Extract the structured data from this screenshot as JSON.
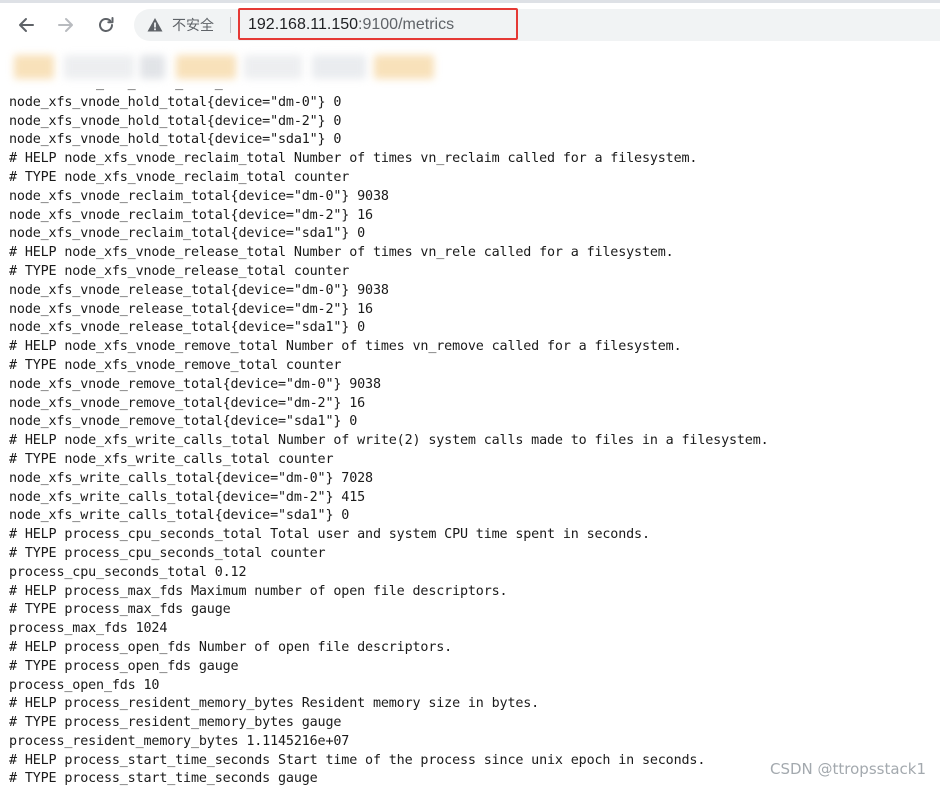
{
  "browser": {
    "security_label": "不安全",
    "url_host": "192.168.11.150",
    "url_port": ":9100",
    "url_path": "/metrics",
    "icons": {
      "back": "back-arrow-icon",
      "forward": "forward-arrow-icon",
      "reload": "reload-icon",
      "security": "warning-triangle-icon"
    },
    "highlight_color": "#e53935"
  },
  "bookmarks_blurred": [
    {
      "color": "#f6d7a3"
    },
    {
      "color": "#e7e9ec"
    },
    {
      "color": "#d8dbe0"
    },
    {
      "color": "#f6d7a3"
    },
    {
      "color": "#e7e9ec"
    },
    {
      "color": "#e3e6ea"
    },
    {
      "color": "#f6d7a3"
    }
  ],
  "metrics_lines": [
    "# TYPE node_xfs_vnode_hold_total counter",
    "node_xfs_vnode_hold_total{device=\"dm-0\"} 0",
    "node_xfs_vnode_hold_total{device=\"dm-2\"} 0",
    "node_xfs_vnode_hold_total{device=\"sda1\"} 0",
    "# HELP node_xfs_vnode_reclaim_total Number of times vn_reclaim called for a filesystem.",
    "# TYPE node_xfs_vnode_reclaim_total counter",
    "node_xfs_vnode_reclaim_total{device=\"dm-0\"} 9038",
    "node_xfs_vnode_reclaim_total{device=\"dm-2\"} 16",
    "node_xfs_vnode_reclaim_total{device=\"sda1\"} 0",
    "# HELP node_xfs_vnode_release_total Number of times vn_rele called for a filesystem.",
    "# TYPE node_xfs_vnode_release_total counter",
    "node_xfs_vnode_release_total{device=\"dm-0\"} 9038",
    "node_xfs_vnode_release_total{device=\"dm-2\"} 16",
    "node_xfs_vnode_release_total{device=\"sda1\"} 0",
    "# HELP node_xfs_vnode_remove_total Number of times vn_remove called for a filesystem.",
    "# TYPE node_xfs_vnode_remove_total counter",
    "node_xfs_vnode_remove_total{device=\"dm-0\"} 9038",
    "node_xfs_vnode_remove_total{device=\"dm-2\"} 16",
    "node_xfs_vnode_remove_total{device=\"sda1\"} 0",
    "# HELP node_xfs_write_calls_total Number of write(2) system calls made to files in a filesystem.",
    "# TYPE node_xfs_write_calls_total counter",
    "node_xfs_write_calls_total{device=\"dm-0\"} 7028",
    "node_xfs_write_calls_total{device=\"dm-2\"} 415",
    "node_xfs_write_calls_total{device=\"sda1\"} 0",
    "# HELP process_cpu_seconds_total Total user and system CPU time spent in seconds.",
    "# TYPE process_cpu_seconds_total counter",
    "process_cpu_seconds_total 0.12",
    "# HELP process_max_fds Maximum number of open file descriptors.",
    "# TYPE process_max_fds gauge",
    "process_max_fds 1024",
    "# HELP process_open_fds Number of open file descriptors.",
    "# TYPE process_open_fds gauge",
    "process_open_fds 10",
    "# HELP process_resident_memory_bytes Resident memory size in bytes.",
    "# TYPE process_resident_memory_bytes gauge",
    "process_resident_memory_bytes 1.1145216e+07",
    "# HELP process_start_time_seconds Start time of the process since unix epoch in seconds.",
    "# TYPE process_start_time_seconds gauge"
  ],
  "watermark": "CSDN @ttropsstack1"
}
